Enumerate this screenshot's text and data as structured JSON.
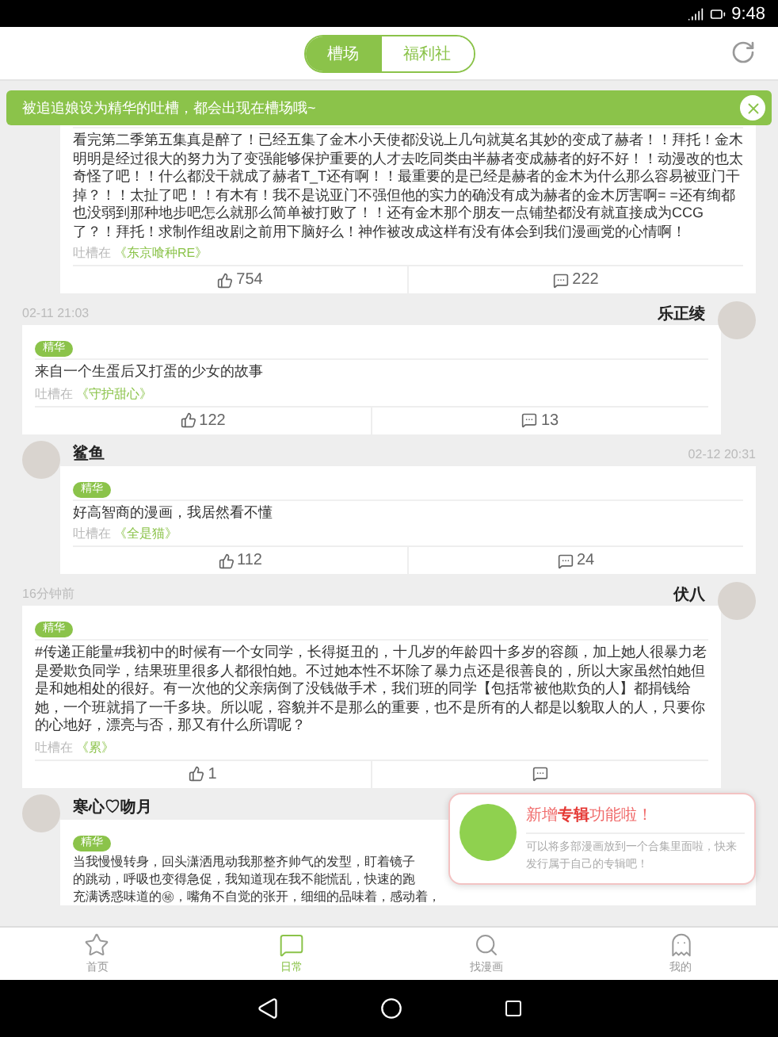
{
  "status_bar": {
    "time": "9:48"
  },
  "header": {
    "tabs": [
      {
        "label": "槽场",
        "selected": true
      },
      {
        "label": "福利社",
        "selected": false
      }
    ]
  },
  "toast": {
    "text": "被追追娘设为精华的吐槽，都会出现在槽场哦~"
  },
  "posts": [
    {
      "kind": "hidden",
      "text": "看完第二季第五集真是醉了！已经五集了金木小天使都没说上几句就莫名其妙的变成了赫者！！拜托！金木明明是经过很大的努力为了变强能够保护重要的人才去吃同类由半赫者变成赫者的好不好！！动漫改的也太奇怪了吧！！什么都没干就成了赫者T_T还有啊！！最重要的是已经是赫者的金木为什么那么容易被亚门干掉？！！太扯了吧！！有木有！我不是说亚门不强但他的实力的确没有成为赫者的金木厉害啊= =还有绚都也没弱到那种地步吧怎么就那么简单被打败了！！还有金木那个朋友一点铺垫都没有就直接成为CCG了？！拜托！求制作组改剧之前用下脑好么！神作被改成这样有没有体会到我们漫画党的心情啊！",
      "source_prefix": "吐槽在",
      "source": "《东京喰种RE》",
      "likes": "754",
      "comments": "222"
    },
    {
      "kind": "right",
      "name": "乐正绫",
      "time": "02-11 21:03",
      "tag": "精华",
      "text": "来自一个生蛋后又打蛋的少女的故事",
      "source_prefix": "吐槽在",
      "source": "《守护甜心》",
      "likes": "122",
      "comments": "13"
    },
    {
      "kind": "left",
      "name": "鲨鱼",
      "time": "02-12 20:31",
      "tag": "精华",
      "text": "好高智商的漫画，我居然看不懂",
      "source_prefix": "吐槽在",
      "source": "《全是猫》",
      "likes": "112",
      "comments": "24"
    },
    {
      "kind": "right",
      "name": "伏八",
      "time": "16分钟前",
      "tag": "精华",
      "text": "#传递正能量#我初中的时候有一个女同学，长得挺丑的，十几岁的年龄四十多岁的容颜，加上她人很暴力老是爱欺负同学，结果班里很多人都很怕她。不过她本性不坏除了暴力点还是很善良的，所以大家虽然怕她但是和她相处的很好。有一次他的父亲病倒了没钱做手术，我们班的同学【包括常被他欺负的人】都捐钱给她，一个班就捐了一千多块。所以呢，容貌并不是那么的重要，也不是所有的人都是以貌取人的人，只要你的心地好，漂亮与否，那又有什么所谓呢？",
      "source_prefix": "吐槽在",
      "source": "《累》",
      "likes": "1"
    },
    {
      "kind": "left-cut",
      "name": "寒心♡吻月",
      "tag": "精华",
      "lines": [
        "当我慢慢转身，回头潇洒甩动我那整齐帅气的发型，盯着镜子",
        "的跳动，呼吸也变得急促，我知道现在我不能慌乱，快速的跑",
        "充满诱惑味道的㊙，嘴角不自觉的张开，细细的品味着，感动着，"
      ]
    }
  ],
  "popup": {
    "title": "新增**专辑**功能啦！",
    "text": "可以将多部漫画放到一个合集里面啦，快来发行属于自己的专辑吧！"
  },
  "bottom_nav": [
    {
      "label": "首页",
      "selected": false
    },
    {
      "label": "日常",
      "selected": true
    },
    {
      "label": "找漫画",
      "selected": false
    },
    {
      "label": "我的",
      "selected": false
    }
  ]
}
